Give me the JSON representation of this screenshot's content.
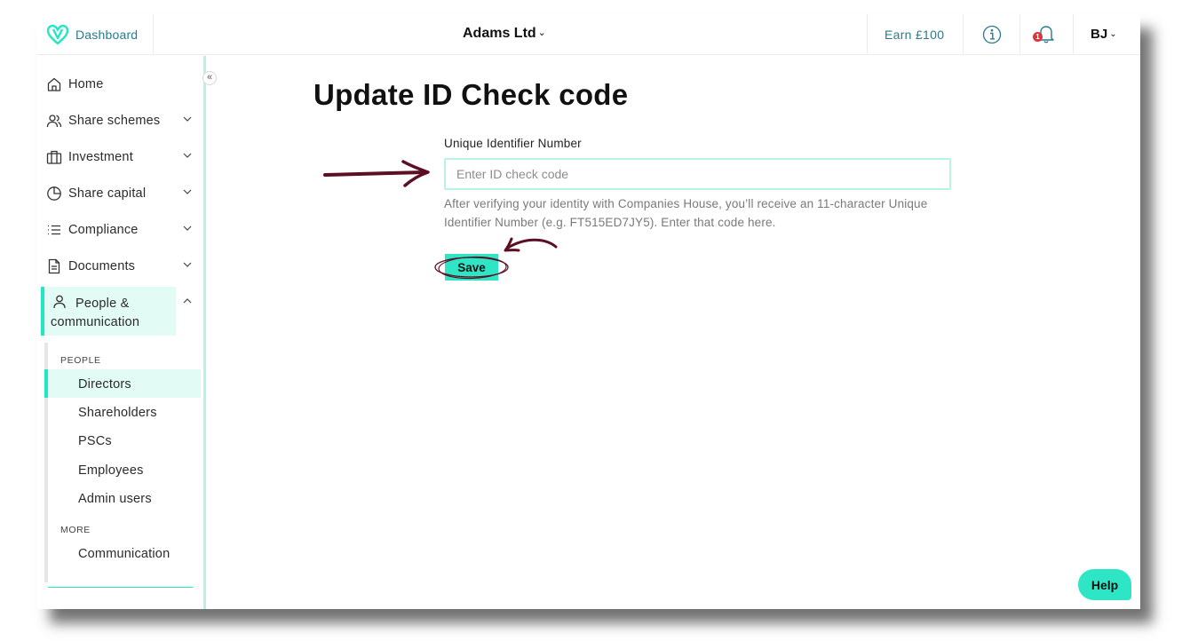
{
  "header": {
    "dashboard_label": "Dashboard",
    "company_name": "Adams Ltd",
    "earn_label": "Earn £100",
    "notification_count": "1",
    "user_initials": "BJ"
  },
  "sidebar": {
    "items": [
      {
        "label": "Home",
        "icon": "home-icon"
      },
      {
        "label": "Share schemes",
        "icon": "users-icon"
      },
      {
        "label": "Investment",
        "icon": "briefcase-icon"
      },
      {
        "label": "Share capital",
        "icon": "pie-chart-icon"
      },
      {
        "label": "Compliance",
        "icon": "list-icon"
      },
      {
        "label": "Documents",
        "icon": "document-icon"
      }
    ],
    "active_section": {
      "label": "People & communication",
      "icon": "person-icon"
    },
    "people_heading": "PEOPLE",
    "people_items": [
      "Directors",
      "Shareholders",
      "PSCs",
      "Employees",
      "Admin users"
    ],
    "more_heading": "MORE",
    "more_items": [
      "Communication"
    ],
    "active_subitem": "Directors"
  },
  "main": {
    "title": "Update ID Check code",
    "field_label": "Unique Identifier Number",
    "input_placeholder": "Enter ID check code",
    "input_value": "",
    "help_text": "After verifying your identity with Companies House, you’ll receive an 11-character Unique Identifier Number (e.g. FT515ED7JY5). Enter that code here.",
    "save_label": "Save"
  },
  "help_button_label": "Help",
  "colors": {
    "accent": "#2ee6c5",
    "accent_light": "#e2fbf5",
    "link": "#2a7a8c",
    "annotation": "#5a0f22",
    "badge": "#e0323c"
  }
}
